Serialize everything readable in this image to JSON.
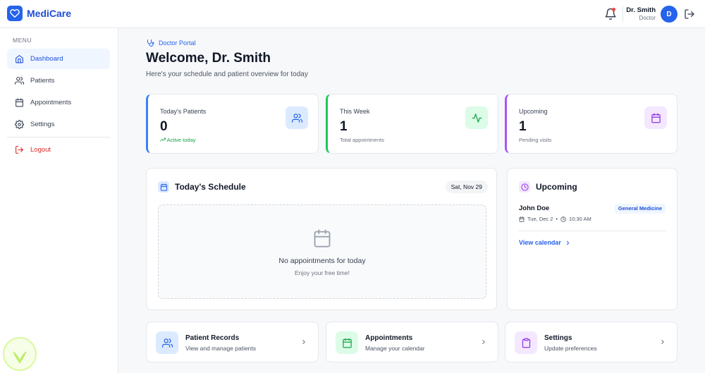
{
  "app": {
    "name": "MediCare"
  },
  "user": {
    "name": "Dr. Smith",
    "role": "Doctor",
    "initial": "D"
  },
  "sidebar": {
    "menu_label": "MENU",
    "items": [
      {
        "label": "Dashboard",
        "icon": "home-icon",
        "active": true
      },
      {
        "label": "Patients",
        "icon": "users-icon"
      },
      {
        "label": "Appointments",
        "icon": "calendar-icon"
      },
      {
        "label": "Settings",
        "icon": "gear-icon"
      }
    ],
    "logout_label": "Logout"
  },
  "header": {
    "portal_label": "Doctor Portal",
    "title": "Welcome, Dr. Smith",
    "subtitle": "Here's your schedule and patient overview for today"
  },
  "stats": [
    {
      "label": "Today's Patients",
      "value": "0",
      "sub": "Active today",
      "icon": "users-icon",
      "accent": "#3b82f6"
    },
    {
      "label": "This Week",
      "value": "1",
      "sub": "Total appointments",
      "icon": "activity-icon",
      "accent": "#22c55e"
    },
    {
      "label": "Upcoming",
      "value": "1",
      "sub": "Pending visits",
      "icon": "calendar-icon",
      "accent": "#a855f7"
    }
  ],
  "schedule": {
    "title": "Today's Schedule",
    "date": "Sat, Nov 29",
    "empty_title": "No appointments for today",
    "empty_sub": "Enjoy your free time!"
  },
  "upcoming": {
    "title": "Upcoming",
    "appointments": [
      {
        "patient": "John Doe",
        "department": "General Medicine",
        "date": "Tue, Dec 2",
        "time": "10:30 AM"
      }
    ],
    "view_calendar_label": "View calendar"
  },
  "quick_links": [
    {
      "title": "Patient Records",
      "sub": "View and manage patients",
      "icon": "users-icon"
    },
    {
      "title": "Appointments",
      "sub": "Manage your calendar",
      "icon": "calendar-icon"
    },
    {
      "title": "Settings",
      "sub": "Update preferences",
      "icon": "clipboard-icon"
    }
  ],
  "colors": {
    "primary": "#2563eb",
    "danger": "#dc2626",
    "success": "#16a34a",
    "purple": "#9333ea"
  }
}
